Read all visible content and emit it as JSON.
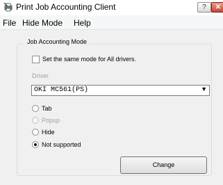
{
  "window": {
    "title": "Print Job Accounting Client",
    "help_glyph": "?",
    "close_glyph": "✕"
  },
  "menu": {
    "file": "File",
    "hide_mode": "Hide Mode",
    "help": "Help"
  },
  "group": {
    "legend": "Job Accounting Mode",
    "same_mode_label": "Set the same mode for All drivers.",
    "same_mode_checked": false,
    "driver_label": "Driver",
    "driver_value": "OKI MC561(PS)",
    "driver_arrow": "▼",
    "modes": [
      {
        "label": "Tab",
        "enabled": true,
        "selected": false
      },
      {
        "label": "Popup",
        "enabled": false,
        "selected": false
      },
      {
        "label": "Hide",
        "enabled": true,
        "selected": false
      },
      {
        "label": "Not supported",
        "enabled": true,
        "selected": true
      }
    ],
    "change_label": "Change"
  }
}
